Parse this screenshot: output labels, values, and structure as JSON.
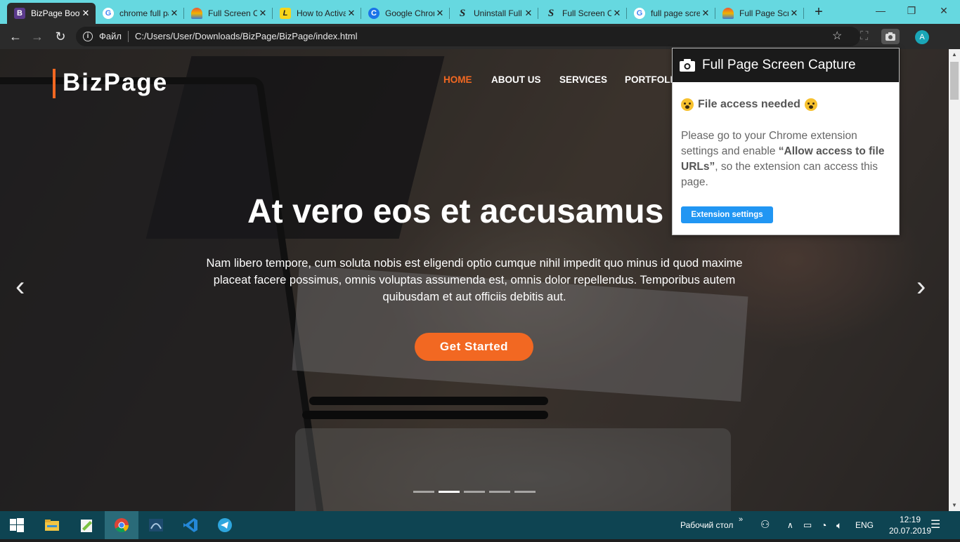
{
  "browser": {
    "tabs": [
      {
        "favicon": "B",
        "title": "BizPage Bootstrap Template",
        "active": true
      },
      {
        "favicon": "G",
        "title": "chrome full page screenshot"
      },
      {
        "favicon": "~",
        "title": "Full Screen Capture"
      },
      {
        "favicon": "L",
        "title": "How to Activate"
      },
      {
        "favicon": "C",
        "title": "Google Chrome"
      },
      {
        "favicon": "S",
        "title": "Uninstall Full Page"
      },
      {
        "favicon": "S",
        "title": "Full Screen Capture"
      },
      {
        "favicon": "G",
        "title": "full page screen capture"
      },
      {
        "favicon": "~",
        "title": "Full Page Screen Capture"
      }
    ],
    "new_tab": "+",
    "window_controls": {
      "minimize": "—",
      "restore": "❐",
      "close": "✕"
    },
    "address_bar": {
      "scheme_label": "Файл",
      "url": "C:/Users/User/Downloads/BizPage/BizPage/index.html"
    },
    "avatar_letter": "A"
  },
  "site": {
    "logo": "BizPage",
    "nav": [
      "HOME",
      "ABOUT US",
      "SERVICES",
      "PORTFOLIO"
    ],
    "hero": {
      "title": "At vero eos et accusamus",
      "text": "Nam libero tempore, cum soluta nobis est eligendi optio cumque nihil impedit quo minus id quod maxime placeat facere possimus, omnis voluptas assumenda est, omnis dolor repellendus. Temporibus autem quibusdam et aut officiis debitis aut.",
      "button": "Get Started"
    },
    "carousel": {
      "slides": 5,
      "active_index": 1
    }
  },
  "popup": {
    "title": "Full Page Screen Capture",
    "heading": "File access needed",
    "body_before": "Please go to your Chrome extension settings and enable ",
    "body_bold": "“Allow access to file URLs”",
    "body_after": ", so the extension can access this page.",
    "button": "Extension settings"
  },
  "taskbar": {
    "apps": [
      "file-explorer-icon",
      "notepad-plus-icon",
      "chrome-icon",
      "sql-server-icon",
      "vscode-icon",
      "telegram-icon"
    ],
    "active_app": "chrome-icon",
    "desktop_label": "Рабочий стол",
    "chevron": "»",
    "language": "ENG",
    "time": "12:19",
    "date": "20.07.2019"
  }
}
